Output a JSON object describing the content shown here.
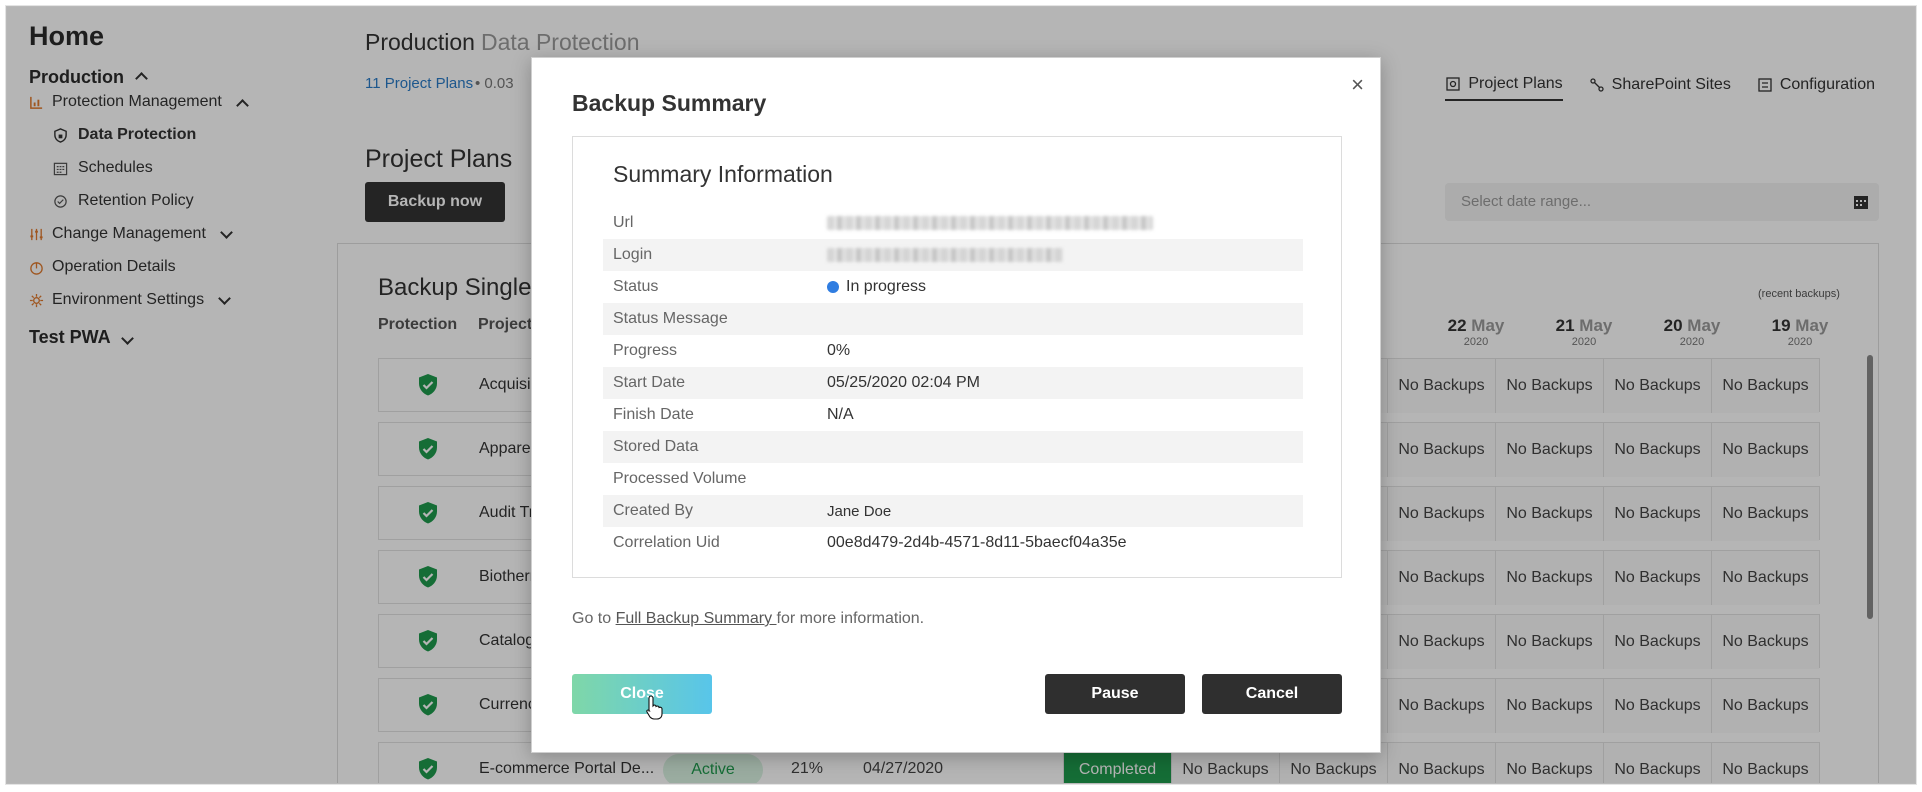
{
  "sidebar": {
    "home": "Home",
    "production": "Production",
    "protection_management": "Protection Management",
    "data_protection": "Data Protection",
    "schedules": "Schedules",
    "retention_policy": "Retention Policy",
    "change_management": "Change Management",
    "operation_details": "Operation Details",
    "environment_settings": "Environment Settings",
    "test_pwa": "Test PWA"
  },
  "header": {
    "title": "Production",
    "subtitle": "Data Protection",
    "plans_link": "11 Project Plans",
    "plans_meta": "• 0.03",
    "tabs": [
      "Project Plans",
      "SharePoint Sites",
      "Configuration"
    ]
  },
  "main": {
    "section_title": "Project Plans",
    "backup_now": "Backup now",
    "date_placeholder": "Select date range...",
    "panel_title": "Backup Single",
    "col_protection": "Protection",
    "col_project": "Project",
    "recent_label": "(recent backups)",
    "dates": [
      {
        "day": "22",
        "month": "May",
        "year": "2020"
      },
      {
        "day": "21",
        "month": "May",
        "year": "2020"
      },
      {
        "day": "20",
        "month": "May",
        "year": "2020"
      },
      {
        "day": "19",
        "month": "May",
        "year": "2020"
      }
    ],
    "rows": [
      {
        "name": "Acquisi"
      },
      {
        "name": "Apparel"
      },
      {
        "name": "Audit Tr"
      },
      {
        "name": "Biotherr"
      },
      {
        "name": "Catalog"
      },
      {
        "name": "Currenc"
      },
      {
        "name": "E-commerce Portal De...",
        "status": "Active",
        "percent": "21%",
        "date": "04/27/2020",
        "last": "Completed"
      }
    ],
    "no_backups": "No Backups",
    "partial_cell": "s"
  },
  "modal": {
    "title": "Backup Summary",
    "close_x": "×",
    "summary_title": "Summary Information",
    "fields": [
      {
        "label": "Url",
        "value": "",
        "blurred": true
      },
      {
        "label": "Login",
        "value": "",
        "blurred": true
      },
      {
        "label": "Status",
        "value": "In progress"
      },
      {
        "label": "Status Message",
        "value": ""
      },
      {
        "label": "Progress",
        "value": "0%"
      },
      {
        "label": "Start Date",
        "value": "05/25/2020 02:04 PM"
      },
      {
        "label": "Finish Date",
        "value": "N/A"
      },
      {
        "label": "Stored Data",
        "value": ""
      },
      {
        "label": "Processed Volume",
        "value": ""
      },
      {
        "label": "Created By",
        "value": "Jane Doe"
      },
      {
        "label": "Correlation Uid",
        "value": "00e8d479-2d4b-4571-8d11-5baecf04a35e"
      }
    ],
    "note_prefix": "Go to ",
    "note_link": "Full Backup Summary ",
    "note_suffix": "for more information.",
    "btn_close": "Close",
    "btn_pause": "Pause",
    "btn_cancel": "Cancel"
  },
  "colors": {
    "accent_green": "#1e9a4c",
    "link_blue": "#2a7bc7",
    "status_blue": "#2f7de1",
    "dark_button": "#2f2f2f"
  }
}
